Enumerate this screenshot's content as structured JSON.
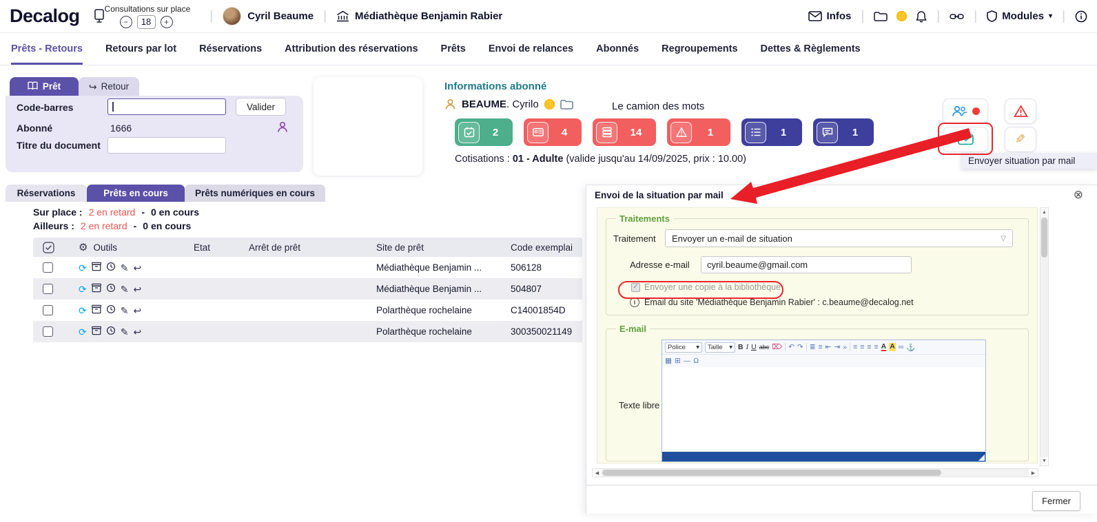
{
  "header": {
    "logo": "Decalog",
    "consultations_label": "Consultations sur place",
    "consultations_count": "18",
    "minus": "−",
    "plus": "+",
    "user_name": "Cyril Beaume",
    "site_name": "Médiathèque Benjamin Rabier",
    "infos_label": "Infos",
    "modules_label": "Modules"
  },
  "nav": {
    "tabs": [
      {
        "label": "Prêts - Retours"
      },
      {
        "label": "Retours par lot"
      },
      {
        "label": "Réservations"
      },
      {
        "label": "Attribution des réservations"
      },
      {
        "label": "Prêts"
      },
      {
        "label": "Envoi de relances"
      },
      {
        "label": "Abonnés"
      },
      {
        "label": "Regroupements"
      },
      {
        "label": "Dettes & Règlements"
      }
    ]
  },
  "loan_form": {
    "tab_pret": "Prêt",
    "tab_retour": "Retour",
    "barcode_label": "Code-barres",
    "valider_button": "Valider",
    "abonne_label": "Abonné",
    "abonne_value": "1666",
    "titre_label": "Titre du document"
  },
  "patron": {
    "section_title": "Informations abonné",
    "name": "BEAUME",
    "name_suffix": ". Cyrilo",
    "group": "Le camion des mots",
    "badges": [
      {
        "count": "2"
      },
      {
        "count": "4"
      },
      {
        "count": "14"
      },
      {
        "count": "1"
      },
      {
        "count": "1"
      },
      {
        "count": "1"
      }
    ],
    "cotisation_label": "Cotisations : ",
    "cotisation_type": "01 - Adulte",
    "cotisation_details": " (valide jusqu'au 14/09/2025, prix : 10.00)",
    "mail_tooltip": "Envoyer situation par mail"
  },
  "loans": {
    "tab_reservations": "Réservations",
    "tab_prets_en_cours": "Prêts en cours",
    "tab_prets_numeriques": "Prêts numériques en cours",
    "sur_place_label": "Sur place :",
    "sur_place_late": "2 en retard",
    "sur_place_dash": "-",
    "sur_place_current": "0 en cours",
    "ailleurs_label": "Ailleurs :",
    "ailleurs_late": "2 en retard",
    "ailleurs_dash": "-",
    "ailleurs_current": "0 en cours",
    "table": {
      "outils_header": "Outils",
      "etat_header": "Etat",
      "arret_header": "Arrêt de prêt",
      "site_header": "Site de prêt",
      "code_header": "Code exemplai",
      "rows": [
        {
          "site": "Médiathèque Benjamin ...",
          "code": "506128"
        },
        {
          "site": "Médiathèque Benjamin ...",
          "code": "504807"
        },
        {
          "site": "Polarthèque rochelaine",
          "code": "C14001854D"
        },
        {
          "site": "Polarthèque rochelaine",
          "code": "300350021149"
        }
      ]
    }
  },
  "dialog": {
    "title": "Envoi de la situation par mail",
    "traitements_legend": "Traitements",
    "traitement_label": "Traitement",
    "traitement_value": "Envoyer un e-mail de situation",
    "email_label": "Adresse e-mail",
    "email_value": "cyril.beaume@gmail.com",
    "copy_label": "Envoyer une copie à la bibliothèque",
    "site_email_note": "Email du site 'Médiathèque Benjamin Rabier' : c.beaume@decalog.net",
    "email_legend": "E-mail",
    "texte_libre_label": "Texte libre",
    "editor": {
      "police": "Police",
      "taille": "Taille",
      "bold": "B",
      "italic": "I",
      "underline": "U",
      "strike": "abc",
      "omega": "Ω"
    },
    "fermer_button": "Fermer"
  }
}
